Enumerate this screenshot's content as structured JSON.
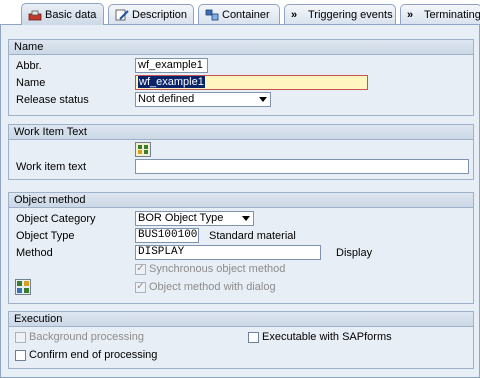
{
  "tabs": [
    {
      "label": "Basic data",
      "icon": "workflow-icon",
      "active": true
    },
    {
      "label": "Description",
      "icon": "edit-icon",
      "active": false
    },
    {
      "label": "Container",
      "icon": "container-icon",
      "active": false
    },
    {
      "label": "Triggering events",
      "icon": "event-arrows-icon",
      "active": false
    },
    {
      "label": "Terminating",
      "icon": "event-arrows-icon",
      "active": false
    }
  ],
  "name_group": {
    "title": "Name",
    "abbr_label": "Abbr.",
    "abbr_value": "wf_example1",
    "name_label": "Name",
    "name_value": "wf_example1",
    "release_label": "Release status",
    "release_value": "Not defined"
  },
  "work_item_group": {
    "title": "Work Item Text",
    "label": "Work item text",
    "value": ""
  },
  "object_method_group": {
    "title": "Object method",
    "category_label": "Object Category",
    "category_value": "BOR Object Type",
    "type_label": "Object Type",
    "type_value": "BUS1001006",
    "type_desc": "Standard material",
    "method_label": "Method",
    "method_value": "DISPLAY",
    "method_desc": "Display",
    "sync_label": "Synchronous object method",
    "dialog_label": "Object method with dialog"
  },
  "execution_group": {
    "title": "Execution",
    "background_label": "Background processing",
    "sapforms_label": "Executable with SAPforms",
    "confirm_label": "Confirm end of processing"
  }
}
